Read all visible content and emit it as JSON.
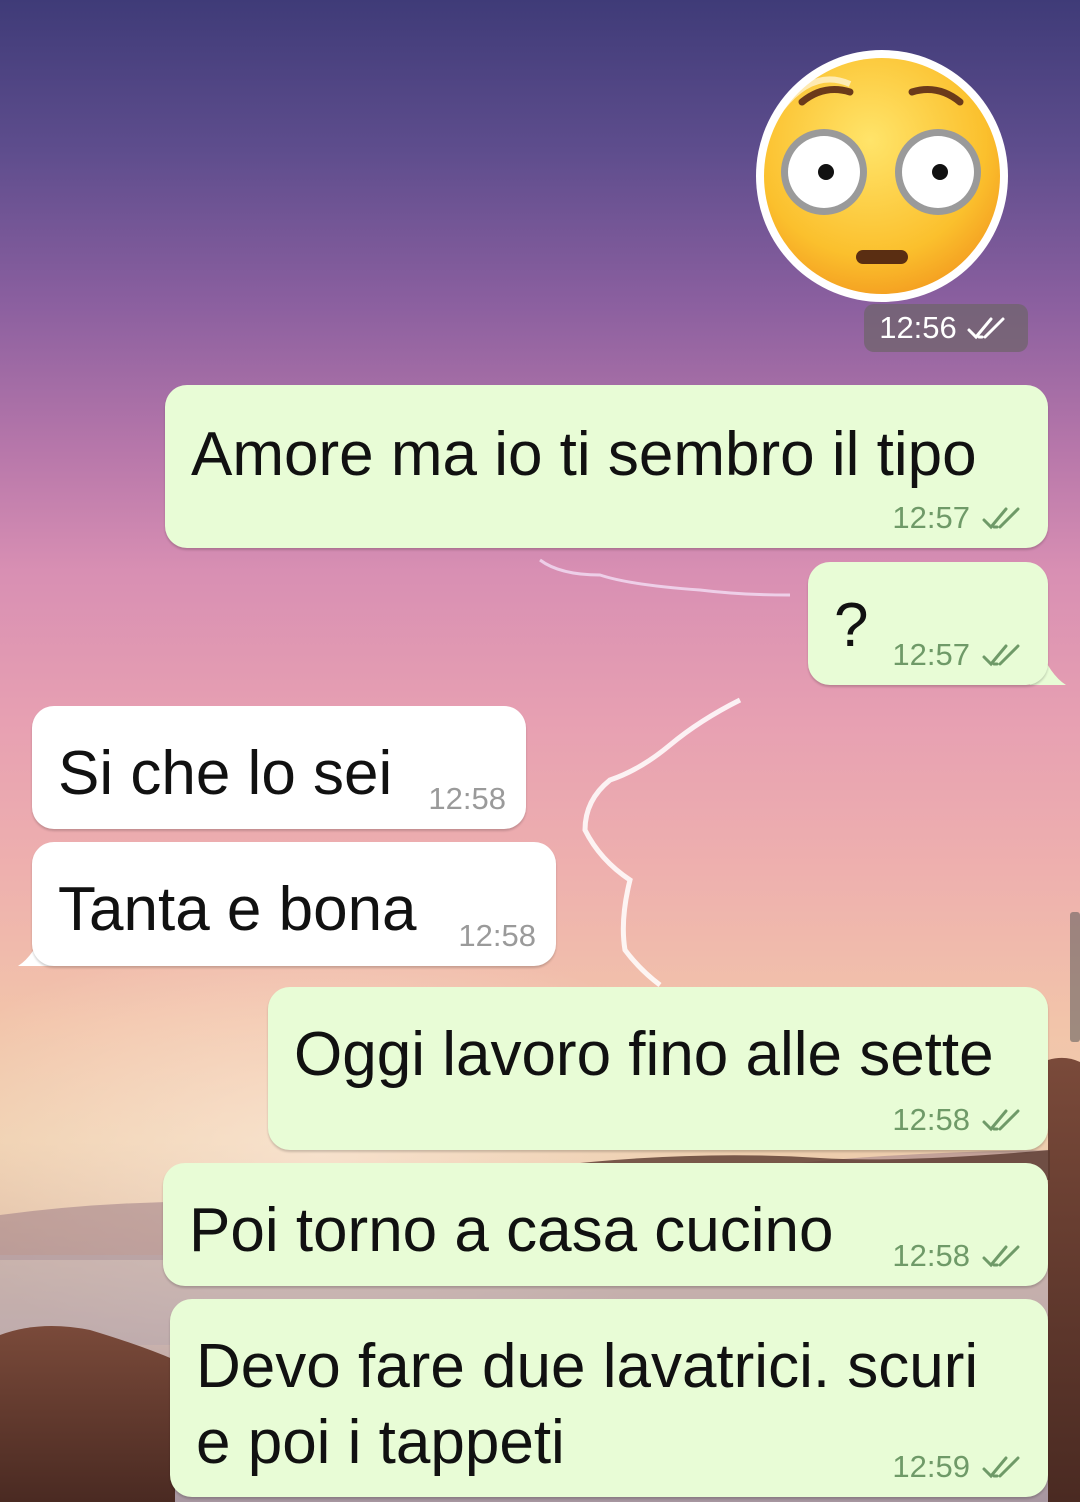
{
  "colors": {
    "outgoing_bubble": "#e8fcd6",
    "incoming_bubble": "#ffffff",
    "outgoing_time": "#6f9a68",
    "incoming_time": "#9a9a9a",
    "read_ticks": "#6f9a68"
  },
  "sticker": {
    "icon": "flushed-face-emoji",
    "time": "12:56",
    "status_icon": "double-check-icon"
  },
  "messages": [
    {
      "direction": "outgoing",
      "text": "Amore ma io ti sembro il tipo",
      "time": "12:57",
      "status_icon": "double-check-icon"
    },
    {
      "direction": "outgoing",
      "text": "?",
      "time": "12:57",
      "status_icon": "double-check-icon"
    },
    {
      "direction": "incoming",
      "text": "Si che lo sei",
      "time": "12:58"
    },
    {
      "direction": "incoming",
      "text": "Tanta e bona",
      "time": "12:58"
    },
    {
      "direction": "outgoing",
      "text": "Oggi lavoro fino alle sette",
      "time": "12:58",
      "status_icon": "double-check-icon"
    },
    {
      "direction": "outgoing",
      "text": "Poi torno a casa cucino",
      "time": "12:58",
      "status_icon": "double-check-icon"
    },
    {
      "direction": "outgoing",
      "text_lines": [
        "Devo fare due lavatrici. scuri",
        "e poi i tappeti"
      ],
      "time": "12:59",
      "status_icon": "double-check-icon"
    }
  ]
}
